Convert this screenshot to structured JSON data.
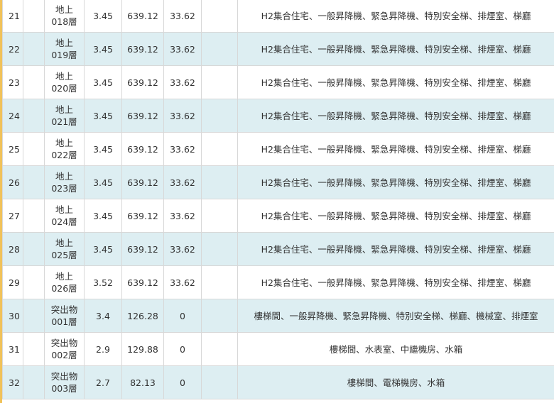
{
  "rows": [
    {
      "no": "21",
      "prefix": "地上",
      "floor": "018層",
      "height": "3.45",
      "area": "639.12",
      "v2": "33.62",
      "use": "H2集合住宅、一般昇降機、緊急昇降機、特別安全梯、排煙室、梯廳"
    },
    {
      "no": "22",
      "prefix": "地上",
      "floor": "019層",
      "height": "3.45",
      "area": "639.12",
      "v2": "33.62",
      "use": "H2集合住宅、一般昇降機、緊急昇降機、特別安全梯、排煙室、梯廳"
    },
    {
      "no": "23",
      "prefix": "地上",
      "floor": "020層",
      "height": "3.45",
      "area": "639.12",
      "v2": "33.62",
      "use": "H2集合住宅、一般昇降機、緊急昇降機、特別安全梯、排煙室、梯廳"
    },
    {
      "no": "24",
      "prefix": "地上",
      "floor": "021層",
      "height": "3.45",
      "area": "639.12",
      "v2": "33.62",
      "use": "H2集合住宅、一般昇降機、緊急昇降機、特別安全梯、排煙室、梯廳"
    },
    {
      "no": "25",
      "prefix": "地上",
      "floor": "022層",
      "height": "3.45",
      "area": "639.12",
      "v2": "33.62",
      "use": "H2集合住宅、一般昇降機、緊急昇降機、特別安全梯、排煙室、梯廳"
    },
    {
      "no": "26",
      "prefix": "地上",
      "floor": "023層",
      "height": "3.45",
      "area": "639.12",
      "v2": "33.62",
      "use": "H2集合住宅、一般昇降機、緊急昇降機、特別安全梯、排煙室、梯廳"
    },
    {
      "no": "27",
      "prefix": "地上",
      "floor": "024層",
      "height": "3.45",
      "area": "639.12",
      "v2": "33.62",
      "use": "H2集合住宅、一般昇降機、緊急昇降機、特別安全梯、排煙室、梯廳"
    },
    {
      "no": "28",
      "prefix": "地上",
      "floor": "025層",
      "height": "3.45",
      "area": "639.12",
      "v2": "33.62",
      "use": "H2集合住宅、一般昇降機、緊急昇降機、特別安全梯、排煙室、梯廳"
    },
    {
      "no": "29",
      "prefix": "地上",
      "floor": "026層",
      "height": "3.52",
      "area": "639.12",
      "v2": "33.62",
      "use": "H2集合住宅、一般昇降機、緊急昇降機、特別安全梯、排煙室、梯廳"
    },
    {
      "no": "30",
      "prefix": "突出物",
      "floor": "001層",
      "height": "3.4",
      "area": "126.28",
      "v2": "0",
      "use": "樓梯間、一般昇降機、緊急昇降機、特別安全梯、梯廳、機械室、排煙室"
    },
    {
      "no": "31",
      "prefix": "突出物",
      "floor": "002層",
      "height": "2.9",
      "area": "129.88",
      "v2": "0",
      "use": "樓梯間、水表室、中繼機房、水箱"
    },
    {
      "no": "32",
      "prefix": "突出物",
      "floor": "003層",
      "height": "2.7",
      "area": "82.13",
      "v2": "0",
      "use": "樓梯間、電梯機房、水箱"
    }
  ]
}
